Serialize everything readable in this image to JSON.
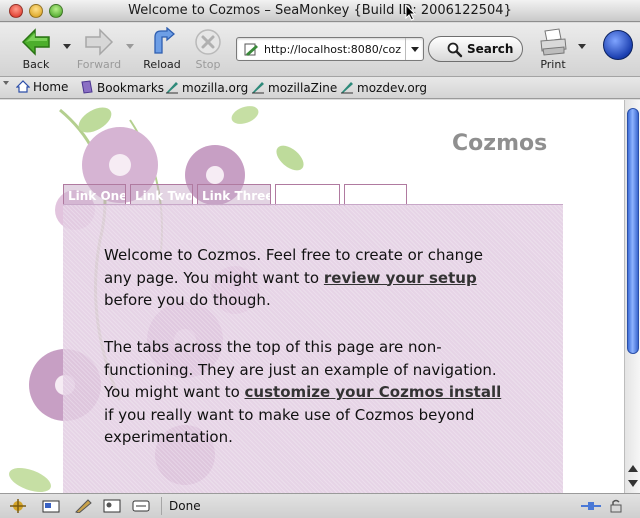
{
  "window": {
    "title": "Welcome to Cozmos – SeaMonkey {Build ID: 2006122504}"
  },
  "toolbar": {
    "back_label": "Back",
    "forward_label": "Forward",
    "reload_label": "Reload",
    "stop_label": "Stop",
    "url_value": "http://localhost:8080/coz",
    "search_label": "Search",
    "print_label": "Print"
  },
  "bookmarks": {
    "items": [
      {
        "label": "Home",
        "icon": "home-icon"
      },
      {
        "label": "Bookmarks",
        "icon": "bookmarks-icon"
      },
      {
        "label": "mozilla.org",
        "icon": "bookmark-page-icon"
      },
      {
        "label": "mozillaZine",
        "icon": "bookmark-page-icon"
      },
      {
        "label": "mozdev.org",
        "icon": "bookmark-page-icon"
      }
    ]
  },
  "page": {
    "site_title": "Cozmos",
    "tabs": [
      "Link One",
      "Link Two",
      "Link Three",
      "",
      ""
    ],
    "para1": {
      "text_a": "Welcome to Cozmos. Feel free to create or change any page. You might want to ",
      "link": "review your setup",
      "text_b": " before you do though."
    },
    "para2": {
      "text_a": "The tabs across the top of this page are non-functioning. They are just an example of navigation. You might want to ",
      "link": "customize your Cozmos install",
      "text_b": " if you really want to make use of Cozmos beyond experimentation."
    }
  },
  "status": {
    "text": "Done"
  },
  "colors": {
    "site_title": "#8f8f8f",
    "panel": "#e2cce2",
    "scroll_thumb": "#5b87e6"
  }
}
